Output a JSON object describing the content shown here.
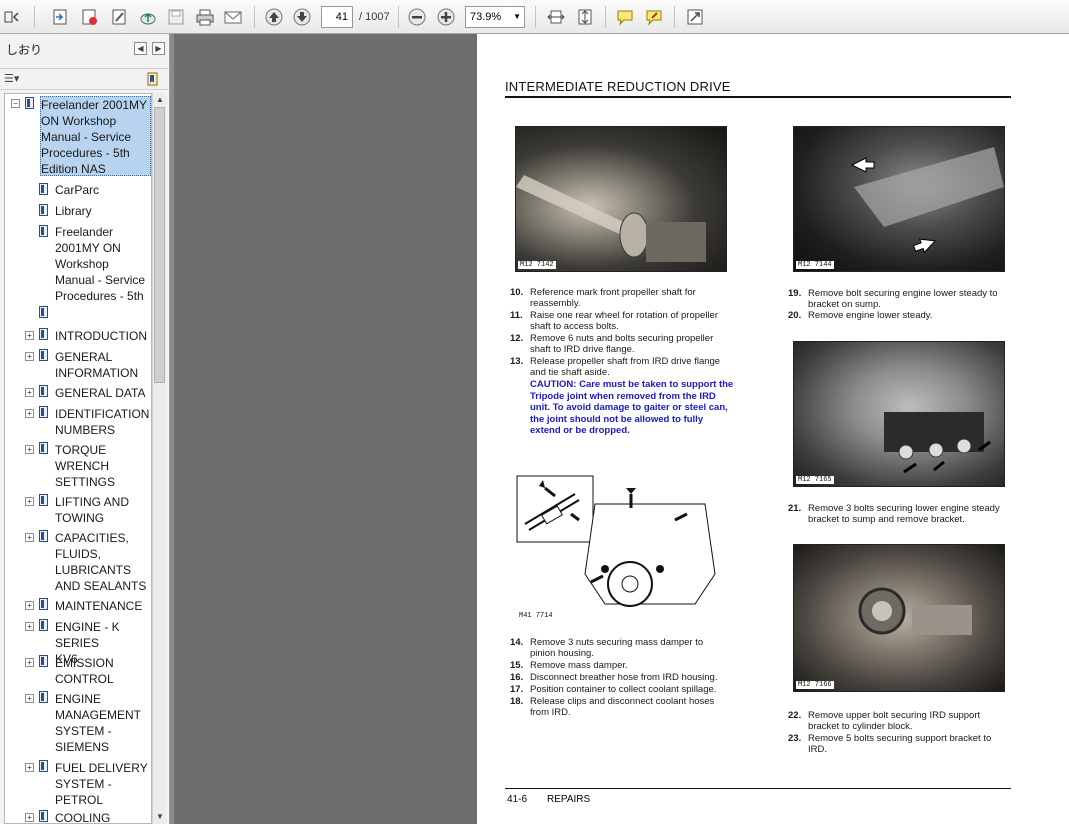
{
  "toolbar": {
    "page_current": "41",
    "page_total": "/ 1007",
    "zoom": "73.9%"
  },
  "panel": {
    "title": "しおり"
  },
  "bookmarks": [
    {
      "label": "Freelander 2001MY ON Workshop Manual - Service Procedures - 5th Edition NAS",
      "selected": true,
      "expandable": true
    },
    {
      "label": "CarParc"
    },
    {
      "label": "Library"
    },
    {
      "label": "Freelander 2001MY ON Workshop Manual - Service Procedures - 5th"
    },
    {
      "label": ""
    },
    {
      "label": "INTRODUCTION",
      "expandable": true
    },
    {
      "label": "GENERAL INFORMATION",
      "expandable": true
    },
    {
      "label": "GENERAL DATA",
      "expandable": true
    },
    {
      "label": "IDENTIFICATION NUMBERS",
      "expandable": true
    },
    {
      "label": "TORQUE WRENCH SETTINGS",
      "expandable": true
    },
    {
      "label": "LIFTING AND TOWING",
      "expandable": true
    },
    {
      "label": "CAPACITIES, FLUIDS, LUBRICANTS AND SEALANTS",
      "expandable": true
    },
    {
      "label": "MAINTENANCE",
      "expandable": true
    },
    {
      "label": "ENGINE - K SERIES KV6",
      "expandable": true
    },
    {
      "label": "EMISSION CONTROL",
      "expandable": true
    },
    {
      "label": "ENGINE MANAGEMENT SYSTEM - SIEMENS",
      "expandable": true
    },
    {
      "label": "FUEL DELIVERY SYSTEM - PETROL",
      "expandable": true
    },
    {
      "label": "COOLING",
      "expandable": true
    }
  ],
  "document": {
    "title": "INTERMEDIATE REDUCTION DRIVE",
    "photos": [
      "M12 7142",
      "M12 7144",
      "M12 7165",
      "M12 7166",
      "M41 7714"
    ],
    "steps_left_a": [
      {
        "n": "10.",
        "t": "Reference mark front propeller shaft for reassembly."
      },
      {
        "n": "11.",
        "t": "Raise one rear wheel for rotation of propeller shaft to access bolts."
      },
      {
        "n": "12.",
        "t": "Remove 6 nuts and bolts securing propeller shaft to IRD drive flange."
      },
      {
        "n": "13.",
        "t": "Release propeller shaft from IRD drive flange and tie shaft aside."
      }
    ],
    "caution": "CAUTION: Care must be taken to support the Tripode joint when removed from the IRD unit. To avoid damage to gaiter or steel can, the joint should not be allowed to fully extend or be dropped.",
    "steps_left_b": [
      {
        "n": "14.",
        "t": "Remove 3 nuts securing mass damper to pinion housing."
      },
      {
        "n": "15.",
        "t": "Remove mass damper."
      },
      {
        "n": "16.",
        "t": "Disconnect breather hose from IRD housing."
      },
      {
        "n": "17.",
        "t": "Position container to collect coolant spillage."
      },
      {
        "n": "18.",
        "t": "Release clips and disconnect coolant hoses from IRD."
      }
    ],
    "steps_right_a": [
      {
        "n": "19.",
        "t": "Remove bolt securing engine lower steady to bracket on sump."
      },
      {
        "n": "20.",
        "t": "Remove engine lower steady."
      }
    ],
    "steps_right_b": [
      {
        "n": "21.",
        "t": "Remove 3 bolts securing lower engine steady bracket to sump and remove bracket."
      }
    ],
    "steps_right_c": [
      {
        "n": "22.",
        "t": "Remove upper bolt securing IRD support bracket to cylinder block."
      },
      {
        "n": "23.",
        "t": "Remove 5 bolts securing support bracket to IRD."
      }
    ],
    "footer_page": "41-6",
    "footer_section": "REPAIRS"
  }
}
